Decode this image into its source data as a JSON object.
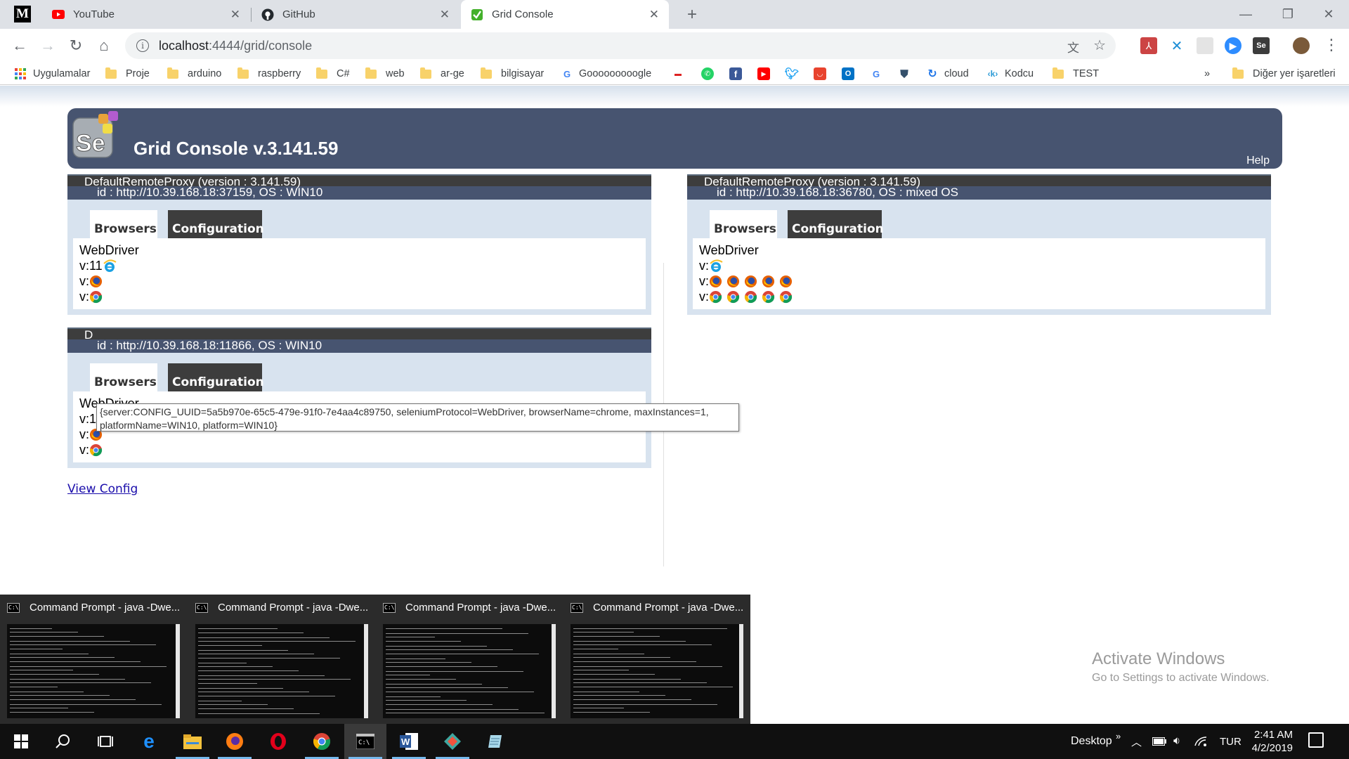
{
  "browser": {
    "tabs": [
      {
        "title": "YouTube",
        "icon": "youtube-icon"
      },
      {
        "title": "GitHub",
        "icon": "github-icon"
      },
      {
        "title": "Grid Console",
        "icon": "selenium-icon",
        "active": true
      }
    ],
    "address": {
      "host": "localhost",
      "path": ":4444/grid/console"
    },
    "bookmarks": [
      {
        "label": "Uygulamalar",
        "icon": "apps-grid-icon"
      },
      {
        "label": "Proje",
        "icon": "folder-icon"
      },
      {
        "label": "arduino",
        "icon": "folder-icon"
      },
      {
        "label": "raspberry",
        "icon": "folder-icon"
      },
      {
        "label": "C#",
        "icon": "folder-icon"
      },
      {
        "label": "web",
        "icon": "folder-icon"
      },
      {
        "label": "ar-ge",
        "icon": "folder-icon"
      },
      {
        "label": "bilgisayar",
        "icon": "folder-icon"
      },
      {
        "label": "Gooooooooogle",
        "icon": "google-icon"
      },
      {
        "label": "cloud",
        "icon": "cloud-icon"
      },
      {
        "label": "Kodcu",
        "icon": "kodcu-icon"
      },
      {
        "label": "TEST",
        "icon": "folder-icon"
      }
    ],
    "bookmarks_overflow": "»",
    "other_bookmarks": "Diğer yer işaretleri"
  },
  "grid": {
    "title": "Grid Console v.3.141.59",
    "help": "Help",
    "proxies": [
      {
        "name": "DefaultRemoteProxy (version : 3.141.59)",
        "id": "id : http://10.39.168.18:37159, OS : WIN10",
        "tab_browsers": "Browsers",
        "tab_config": "Configuration",
        "protocol": "WebDriver",
        "rows": [
          {
            "prefix": "v:11",
            "icons": [
              "ie"
            ]
          },
          {
            "prefix": "v:",
            "icons": [
              "firefox"
            ]
          },
          {
            "prefix": "v:",
            "icons": [
              "chrome"
            ]
          }
        ]
      },
      {
        "name": "DefaultRemoteProxy (version : 3.141.59)",
        "id": "id : http://10.39.168.18:36780, OS : mixed OS",
        "tab_browsers": "Browsers",
        "tab_config": "Configuration",
        "protocol": "WebDriver",
        "rows": [
          {
            "prefix": "v:",
            "icons": [
              "ie"
            ]
          },
          {
            "prefix": "v:",
            "icons": [
              "firefox",
              "firefox",
              "firefox",
              "firefox",
              "firefox"
            ]
          },
          {
            "prefix": "v:",
            "icons": [
              "chrome",
              "chrome",
              "chrome",
              "chrome",
              "chrome"
            ]
          }
        ]
      },
      {
        "name": "D",
        "id": "id : http://10.39.168.18:11866, OS : WIN10",
        "tab_browsers": "Browsers",
        "tab_config": "Configuration",
        "protocol": "WebDriver",
        "rows": [
          {
            "prefix": "v:11",
            "icons": [
              "ie"
            ]
          },
          {
            "prefix": "v:",
            "icons": [
              "firefox"
            ]
          },
          {
            "prefix": "v:",
            "icons": [
              "chrome"
            ]
          }
        ]
      }
    ],
    "tooltip": "{server:CONFIG_UUID=5a5b970e-65c5-479e-91f0-7e4aa4c89750, seleniumProtocol=WebDriver, browserName=chrome, maxInstances=1,\nplatformName=WIN10, platform=WIN10}",
    "view_config": "View Config"
  },
  "taskbar_preview": [
    {
      "title": "Command Prompt - java  -Dwe..."
    },
    {
      "title": "Command Prompt - java  -Dwe..."
    },
    {
      "title": "Command Prompt - java  -Dwe..."
    },
    {
      "title": "Command Prompt - java  -Dwe..."
    }
  ],
  "watermark": {
    "line1": "Activate Windows",
    "line2": "Go to Settings to activate Windows."
  },
  "taskbar": {
    "desktop_label": "Desktop",
    "overflow": "»",
    "language": "TUR",
    "time": "2:41 AM",
    "date": "4/2/2019",
    "apps": [
      "windows-start-icon",
      "search-icon",
      "task-view-icon",
      "edge-icon",
      "file-explorer-icon",
      "firefox-icon",
      "opera-icon",
      "chrome-icon",
      "command-prompt-icon",
      "word-icon",
      "gitkraken-icon",
      "notepad-icon"
    ]
  },
  "colors": {
    "header": "#475470",
    "proxy_head": "#3d3d3d",
    "proxy_body": "#d8e3ef",
    "link": "#1a0dab"
  }
}
